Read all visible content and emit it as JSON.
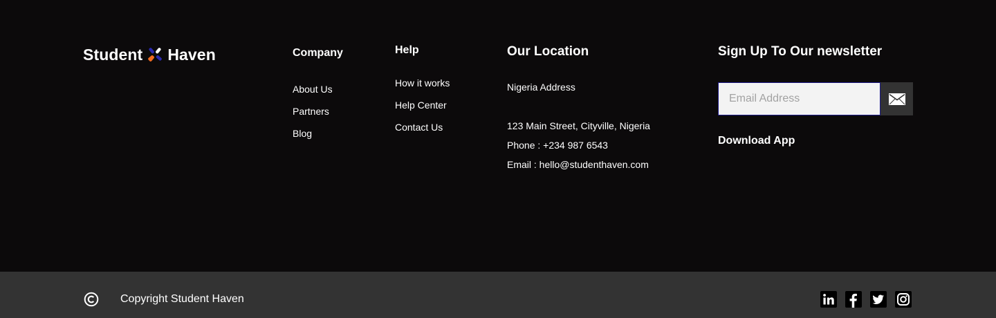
{
  "brand": {
    "name_left": "Student",
    "name_right": "Haven",
    "colors": {
      "orange": "#f26b21",
      "blue": "#2b2ab0",
      "white": "#ffffff"
    }
  },
  "company": {
    "heading": "Company",
    "links": [
      "About Us",
      "Partners",
      "Blog"
    ]
  },
  "help": {
    "heading": "Help",
    "links": [
      "How it works",
      "Help Center",
      "Contact Us"
    ]
  },
  "location": {
    "heading": "Our Location",
    "country": "Nigeria Address",
    "street": "123 Main Street, Cityville, Nigeria",
    "phone": "Phone : +234 987 6543",
    "email": "Email : hello@studenthaven.com"
  },
  "newsletter": {
    "heading": "Sign Up To Our newsletter",
    "email_placeholder": "Email Address",
    "email_value": "",
    "submit_icon": "envelope-icon",
    "download_app": "Download App"
  },
  "bottom": {
    "copyright_icon": "copyright-icon",
    "copyright_text": "Copyright Student Haven",
    "social": [
      "linkedin-icon",
      "facebook-icon",
      "twitter-icon",
      "instagram-icon"
    ]
  },
  "colors": {
    "page_bg": "#0c0a0b",
    "bottom_bar_bg": "#333333",
    "input_bg": "#f3f3f3",
    "input_border": "#1d1a8a"
  }
}
